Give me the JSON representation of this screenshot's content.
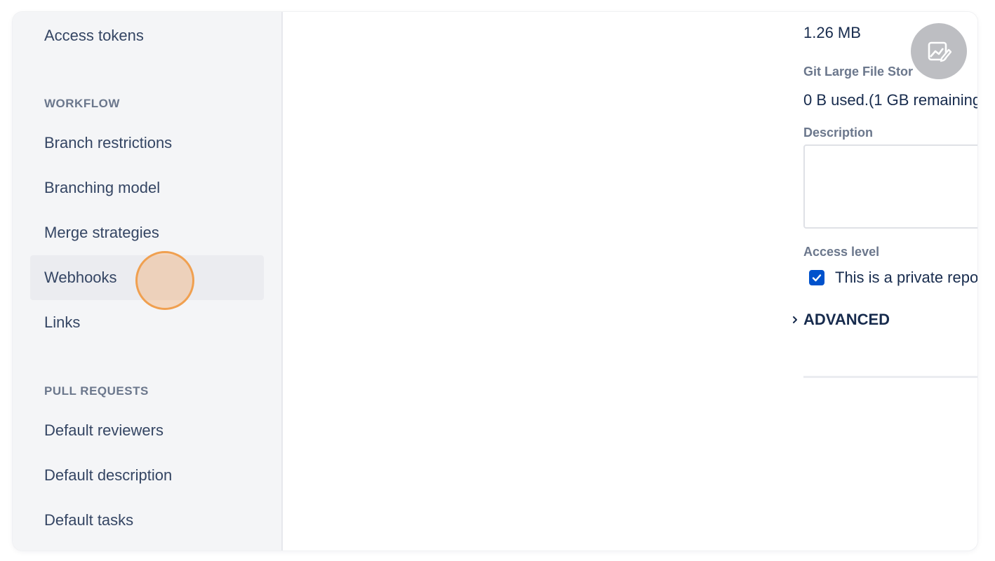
{
  "sidebar": {
    "top_item": {
      "label": "Access tokens"
    },
    "workflow_heading": "WORKFLOW",
    "workflow_items": [
      {
        "label": "Branch restrictions"
      },
      {
        "label": "Branching model"
      },
      {
        "label": "Merge strategies"
      },
      {
        "label": "Webhooks",
        "active": true
      },
      {
        "label": "Links"
      }
    ],
    "pull_requests_heading": "PULL REQUESTS",
    "pull_request_items": [
      {
        "label": "Default reviewers"
      },
      {
        "label": "Default description"
      },
      {
        "label": "Default tasks"
      }
    ]
  },
  "main": {
    "size_value": "1.26 MB",
    "lfs_label": "Git Large File Stor",
    "lfs_value": "0 B used.(1 GB remaining",
    "description_label": "Description",
    "description_value": "",
    "access_level_label": "Access level",
    "private_checkbox": {
      "checked": true,
      "label": "This is a private repo"
    },
    "advanced_label": "ADVANCED"
  },
  "floating_button": {
    "icon": "image-edit-icon"
  },
  "colors": {
    "accent": "#0052cc",
    "sidebar_bg": "#f4f5f7",
    "active_item_bg": "#ebecf0",
    "text_primary": "#172b4d",
    "text_secondary": "#6b778c",
    "cursor_highlight": "#f0a050"
  }
}
